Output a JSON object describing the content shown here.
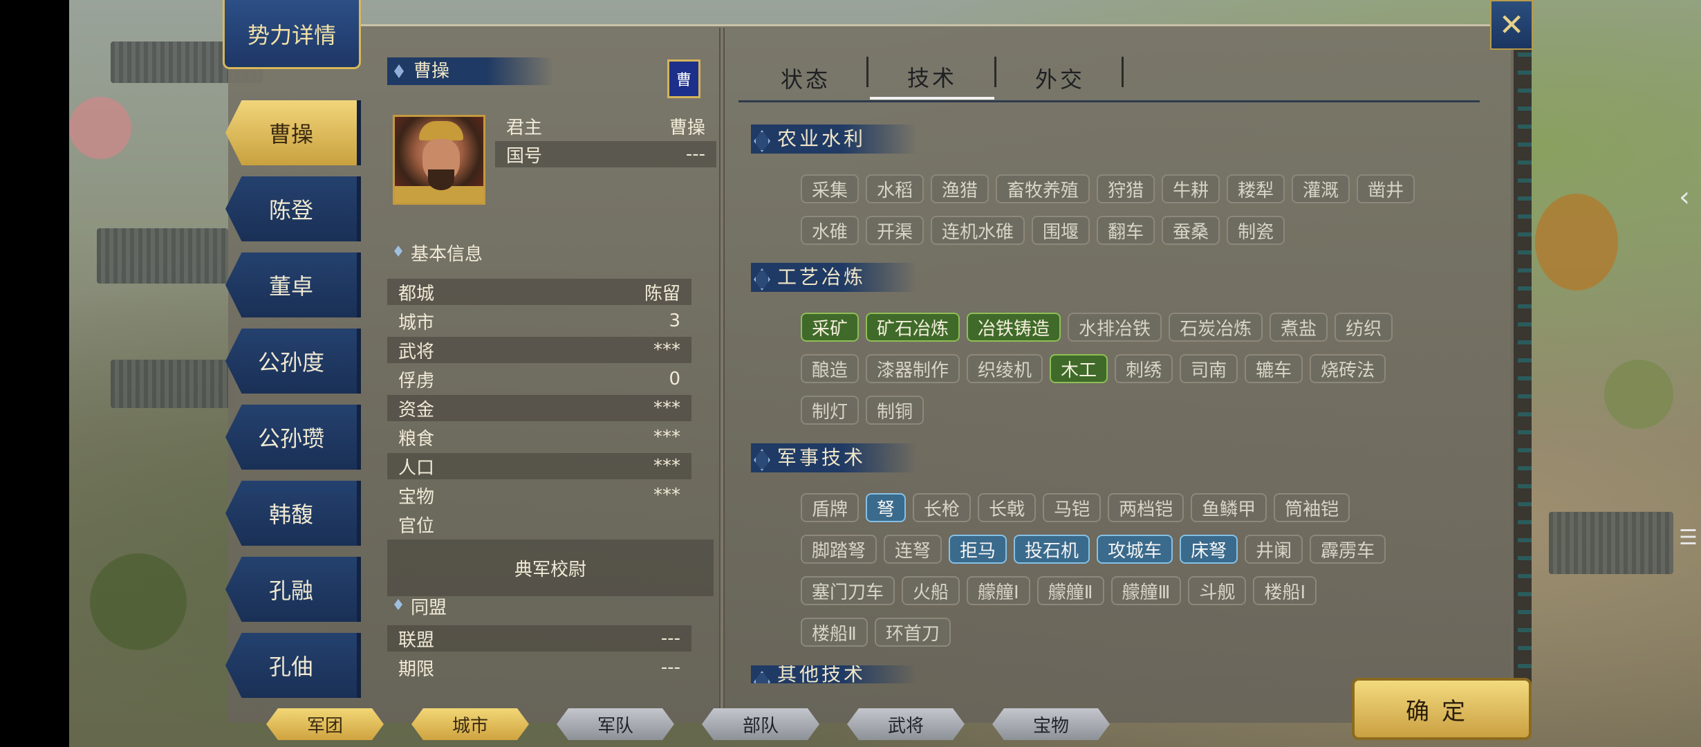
{
  "window": {
    "title": "势力详情",
    "close_icon": "crossed-weapons-icon"
  },
  "factions": [
    "曹操",
    "陈登",
    "董卓",
    "公孙度",
    "公孙瓒",
    "韩馥",
    "孔融",
    "孔伷"
  ],
  "active_faction": "曹操",
  "leader": {
    "name": "曹操",
    "flag_char": "曹",
    "ruler_label": "君主",
    "ruler_value": "曹操",
    "nation_label": "国号",
    "nation_value": "---"
  },
  "basic_info": {
    "title": "基本信息",
    "rows": [
      {
        "k": "都城",
        "v": "陈留"
      },
      {
        "k": "城市",
        "v": "3"
      },
      {
        "k": "武将",
        "v": "***"
      },
      {
        "k": "俘虏",
        "v": "0"
      },
      {
        "k": "资金",
        "v": "***"
      },
      {
        "k": "粮食",
        "v": "***"
      },
      {
        "k": "人口",
        "v": "***"
      },
      {
        "k": "宝物",
        "v": "***"
      },
      {
        "k": "官位",
        "v": ""
      }
    ],
    "official_title": "典军校尉"
  },
  "alliance": {
    "title": "同盟",
    "rows": [
      {
        "k": "联盟",
        "v": "---"
      },
      {
        "k": "期限",
        "v": "---"
      }
    ]
  },
  "tabs": [
    "状态",
    "技术",
    "外交"
  ],
  "active_tab": "技术",
  "tech": {
    "agri": {
      "title": "农业水利",
      "row1": [
        {
          "label": "采集",
          "state": "none"
        },
        {
          "label": "水稻",
          "state": "none"
        },
        {
          "label": "渔猎",
          "state": "none"
        },
        {
          "label": "畜牧养殖",
          "state": "none"
        },
        {
          "label": "狩猎",
          "state": "none"
        },
        {
          "label": "牛耕",
          "state": "none"
        },
        {
          "label": "耧犁",
          "state": "none"
        },
        {
          "label": "灌溉",
          "state": "none"
        },
        {
          "label": "凿井",
          "state": "none"
        }
      ],
      "row2": [
        {
          "label": "水碓",
          "state": "none"
        },
        {
          "label": "开渠",
          "state": "none"
        },
        {
          "label": "连机水碓",
          "state": "none"
        },
        {
          "label": "围堰",
          "state": "none"
        },
        {
          "label": "翻车",
          "state": "none"
        },
        {
          "label": "蚕桑",
          "state": "none"
        },
        {
          "label": "制瓷",
          "state": "none"
        }
      ]
    },
    "craft": {
      "title": "工艺冶炼",
      "row1": [
        {
          "label": "采矿",
          "state": "green"
        },
        {
          "label": "矿石冶炼",
          "state": "green"
        },
        {
          "label": "冶铁铸造",
          "state": "green"
        },
        {
          "label": "水排冶铁",
          "state": "none"
        },
        {
          "label": "石炭冶炼",
          "state": "none"
        },
        {
          "label": "煮盐",
          "state": "none"
        },
        {
          "label": "纺织",
          "state": "none"
        }
      ],
      "row2": [
        {
          "label": "酿造",
          "state": "none"
        },
        {
          "label": "漆器制作",
          "state": "none"
        },
        {
          "label": "织绫机",
          "state": "none"
        },
        {
          "label": "木工",
          "state": "green"
        },
        {
          "label": "刺绣",
          "state": "none"
        },
        {
          "label": "司南",
          "state": "none"
        },
        {
          "label": "辘车",
          "state": "none"
        },
        {
          "label": "烧砖法",
          "state": "none"
        }
      ],
      "row3": [
        {
          "label": "制灯",
          "state": "none"
        },
        {
          "label": "制铜",
          "state": "none"
        }
      ]
    },
    "military": {
      "title": "军事技术",
      "row1": [
        {
          "label": "盾牌",
          "state": "none"
        },
        {
          "label": "弩",
          "state": "blue"
        },
        {
          "label": "长枪",
          "state": "none"
        },
        {
          "label": "长戟",
          "state": "none"
        },
        {
          "label": "马铠",
          "state": "none"
        },
        {
          "label": "两档铠",
          "state": "none"
        },
        {
          "label": "鱼鳞甲",
          "state": "none"
        },
        {
          "label": "筒袖铠",
          "state": "none"
        }
      ],
      "row2": [
        {
          "label": "脚踏弩",
          "state": "none"
        },
        {
          "label": "连弩",
          "state": "none"
        },
        {
          "label": "拒马",
          "state": "blue"
        },
        {
          "label": "投石机",
          "state": "blue"
        },
        {
          "label": "攻城车",
          "state": "blue"
        },
        {
          "label": "床弩",
          "state": "blue"
        },
        {
          "label": "井阑",
          "state": "none"
        },
        {
          "label": "霹雳车",
          "state": "none"
        }
      ],
      "row3": [
        {
          "label": "塞门刀车",
          "state": "none"
        },
        {
          "label": "火船",
          "state": "none"
        },
        {
          "label": "艨艟Ⅰ",
          "state": "none"
        },
        {
          "label": "艨艟Ⅱ",
          "state": "none"
        },
        {
          "label": "艨艟Ⅲ",
          "state": "none"
        },
        {
          "label": "斗舰",
          "state": "none"
        },
        {
          "label": "楼船Ⅰ",
          "state": "none"
        }
      ],
      "row4": [
        {
          "label": "楼船Ⅱ",
          "state": "none"
        },
        {
          "label": "环首刀",
          "state": "none"
        }
      ]
    },
    "other": {
      "title": "其他技术"
    }
  },
  "bottom_nav": [
    {
      "label": "军团",
      "style": "gold"
    },
    {
      "label": "城市",
      "style": "gold"
    },
    {
      "label": "军队",
      "style": "grey"
    },
    {
      "label": "部队",
      "style": "grey"
    },
    {
      "label": "武将",
      "style": "grey"
    },
    {
      "label": "宝物",
      "style": "grey"
    }
  ],
  "confirm_label": "确定"
}
